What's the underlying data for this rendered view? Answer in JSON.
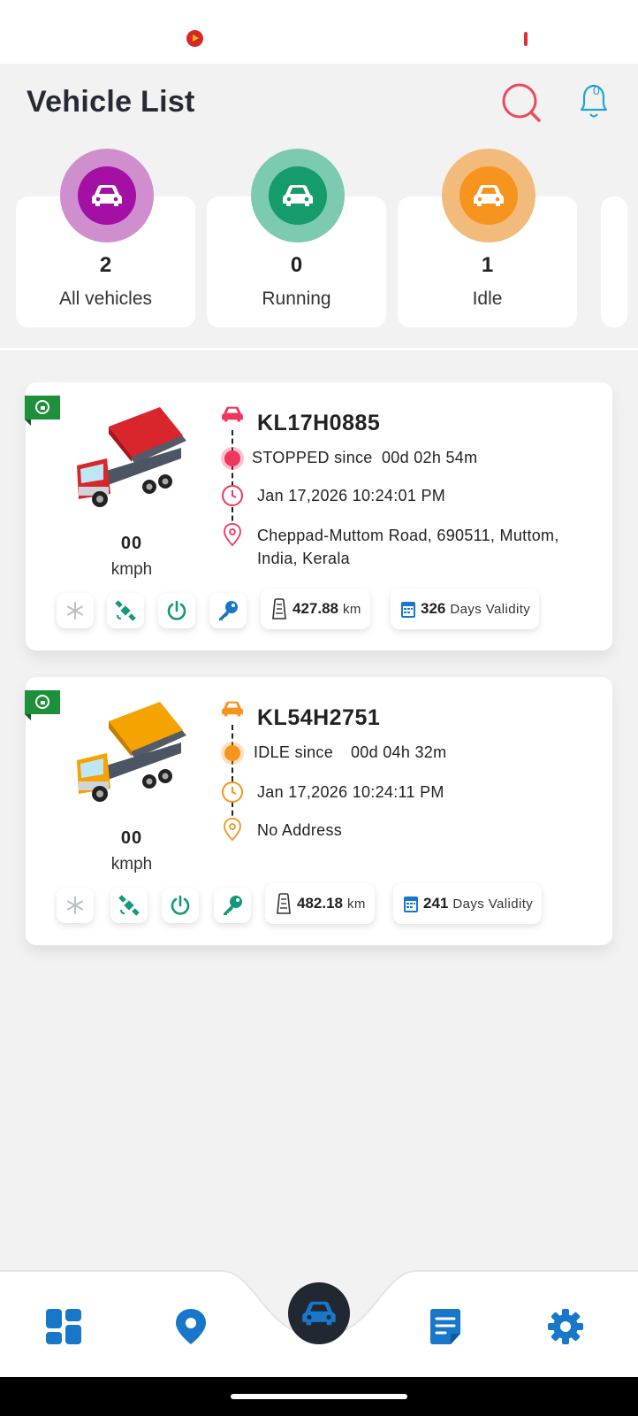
{
  "header": {
    "title": "Vehicle List",
    "notification_count": "0"
  },
  "summary": [
    {
      "count": "2",
      "label": "All vehicles",
      "color": "#a310a3",
      "ring": "#c67bc6"
    },
    {
      "count": "0",
      "label": "Running",
      "color": "#169b6b",
      "ring": "#6fc2a3"
    },
    {
      "count": "1",
      "label": "Idle",
      "color": "#f7941d",
      "ring": "#f0b26a"
    }
  ],
  "vehicles": [
    {
      "plate": "KL17H0885",
      "status": "STOPPED since",
      "duration": "00d 02h 54m",
      "timestamp": "Jan 17,2026 10:24:01 PM",
      "address": "Cheppad-Muttom Road, 690511, Muttom, India, Kerala",
      "speed": "00",
      "speed_unit": "kmph",
      "distance": "427.88",
      "distance_unit": "km",
      "validity_days": "326",
      "validity_label": "Days Validity",
      "accent": "#f0365e",
      "truck_color": "#d9262c"
    },
    {
      "plate": "KL54H2751",
      "status": "IDLE since",
      "duration": "00d 04h 32m",
      "timestamp": "Jan 17,2026 10:24:11 PM",
      "address": "No Address",
      "speed": "00",
      "speed_unit": "kmph",
      "distance": "482.18",
      "distance_unit": "km",
      "validity_days": "241",
      "validity_label": "Days Validity",
      "accent": "#f7941d",
      "truck_color": "#f5a300"
    }
  ],
  "colors": {
    "accent_blue": "#1877c9",
    "teal": "#13997a"
  },
  "icons": [
    "search-icon",
    "bell-icon",
    "car-icon",
    "lock-icon",
    "snowflake-icon",
    "satellite-icon",
    "power-icon",
    "key-icon",
    "odometer-icon",
    "calendar-icon",
    "dashboard-icon",
    "map-pin-icon",
    "report-icon",
    "settings-icon"
  ]
}
